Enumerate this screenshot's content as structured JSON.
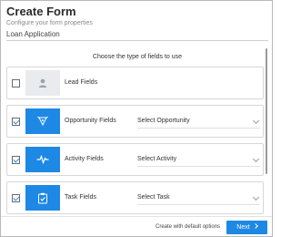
{
  "dialog": {
    "title": "Create Form",
    "subtitle": "Configure your form properties"
  },
  "form_name": {
    "value": "Loan Application"
  },
  "prompt": "Choose the type of fields to use",
  "rows": [
    {
      "label": "Lead Fields",
      "checked": false,
      "icon": "user-icon",
      "select": null
    },
    {
      "label": "Opportunity Fields",
      "checked": true,
      "icon": "opportunity-icon",
      "select": "Select Opportunity"
    },
    {
      "label": "Activity Fields",
      "checked": true,
      "icon": "activity-icon",
      "select": "Select Activity"
    },
    {
      "label": "Task Fields",
      "checked": true,
      "icon": "task-icon",
      "select": "Select Task"
    }
  ],
  "footer": {
    "default_link": "Create with default options",
    "next_label": "Next"
  },
  "colors": {
    "accent": "#1e88e5",
    "tile_inactive": "#e9ebee"
  }
}
